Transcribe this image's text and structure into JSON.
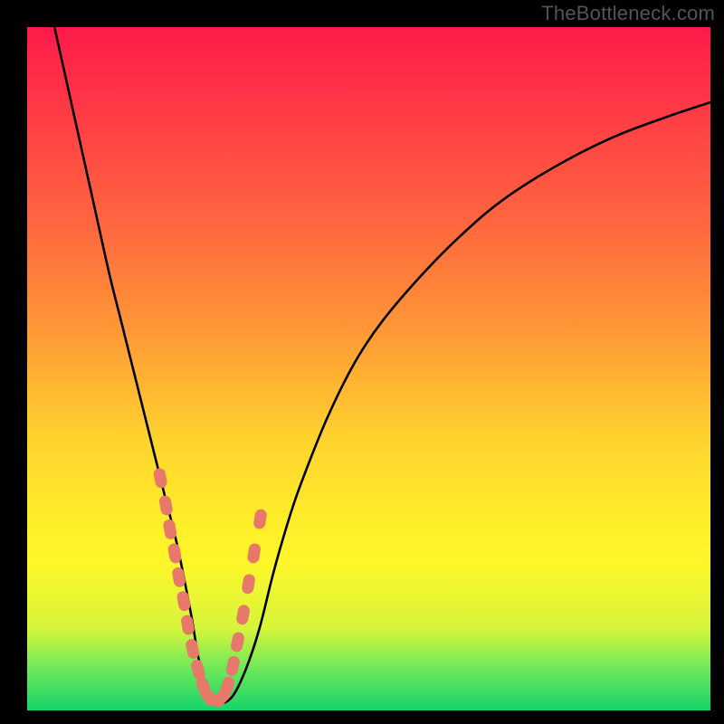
{
  "watermark": "TheBottleneck.com",
  "colors": {
    "frame": "#000000",
    "gradient_stops": [
      "#ff1a4a",
      "#ff3a46",
      "#ff6a3e",
      "#ff9a36",
      "#ffd22e",
      "#ffe92a",
      "#fff62a",
      "#d6f53a",
      "#6be85a",
      "#16d46a"
    ],
    "curve_stroke": "#000000",
    "marker_fill": "#e8786a"
  },
  "chart_data": {
    "type": "line",
    "title": "",
    "xlabel": "",
    "ylabel": "",
    "xlim": [
      0,
      100
    ],
    "ylim": [
      0,
      100
    ],
    "grid": false,
    "legend": false,
    "series": [
      {
        "name": "bottleneck-curve",
        "x": [
          4,
          6,
          8,
          10,
          12,
          14,
          16,
          18,
          20,
          22,
          24,
          25,
          26,
          27,
          28,
          30,
          32,
          34,
          36,
          38,
          40,
          44,
          48,
          52,
          58,
          64,
          70,
          78,
          86,
          94,
          100
        ],
        "y": [
          100,
          91,
          82,
          73,
          64,
          56,
          48,
          40,
          32,
          24,
          14,
          8,
          4,
          2,
          1,
          2,
          6,
          12,
          20,
          27,
          33,
          43,
          51,
          57,
          64,
          70,
          75,
          80,
          84,
          87,
          89
        ]
      }
    ],
    "markers": {
      "name": "highlight-points",
      "x": [
        19.5,
        20.3,
        20.9,
        21.6,
        22.2,
        22.9,
        23.5,
        24.2,
        25.0,
        25.8,
        26.6,
        27.4,
        28.4,
        29.3,
        30.1,
        30.8,
        31.6,
        32.4,
        33.2,
        34.1
      ],
      "y": [
        34.0,
        30.0,
        26.5,
        23.0,
        19.5,
        16.0,
        12.5,
        9.0,
        6.0,
        3.5,
        2.0,
        1.5,
        1.8,
        3.5,
        6.5,
        10.0,
        14.0,
        18.5,
        23.0,
        28.0
      ]
    }
  }
}
